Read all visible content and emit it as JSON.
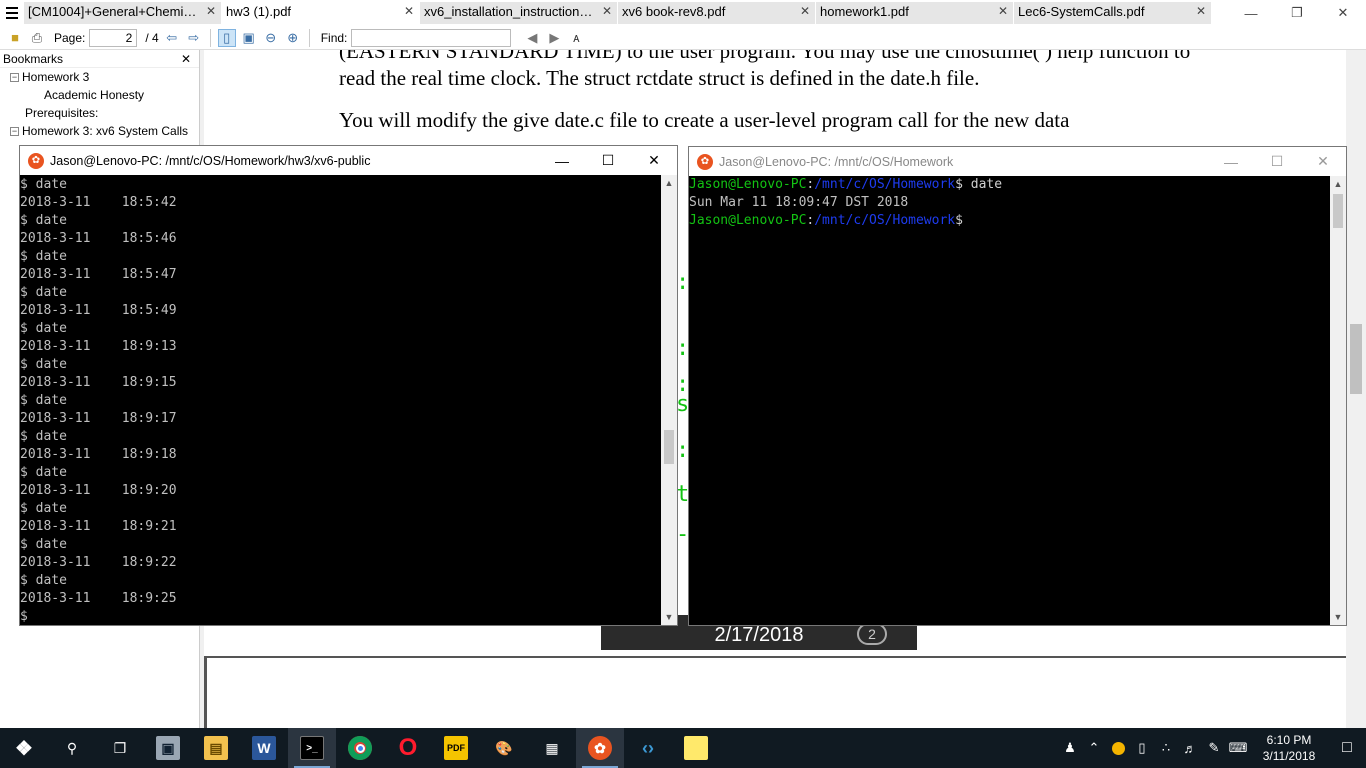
{
  "viewer": {
    "tabs": [
      {
        "label": "[CM1004]+General+Chemistr..."
      },
      {
        "label": "hw3 (1).pdf"
      },
      {
        "label": "xv6_installation_instructions (..."
      },
      {
        "label": "xv6 book-rev8.pdf"
      },
      {
        "label": "homework1.pdf"
      },
      {
        "label": "Lec6-SystemCalls.pdf"
      }
    ],
    "tab_close": "✕",
    "page_label": "Page:",
    "page_value": "2",
    "page_total": "/ 4",
    "find_label": "Find:",
    "bookmarks_title": "Bookmarks",
    "bookmarks_close": "✕",
    "bookmarks": [
      {
        "label": "Homework 3"
      },
      {
        "label": "Academic Honesty"
      },
      {
        "label": "Prerequisites:"
      },
      {
        "label": "Homework 3: xv6 System Calls"
      }
    ],
    "doc_paragraphs": [
      "(EASTERN STANDARD TIME) to the user program. You may use the cmosttime( ) help function to read the real time clock. The struct rctdate struct is defined in the date.h file.",
      "You will modify the give date.c file to create a user-level program call for the new data"
    ],
    "doc_image_text": "2/17/2018",
    "doc_image_badge": "2"
  },
  "term_left": {
    "title": "Jason@Lenovo-PC: /mnt/c/OS/Homework/hw3/xv6-public",
    "lines": [
      "$ date",
      "2018-3-11    18:5:42",
      "$ date",
      "2018-3-11    18:5:46",
      "$ date",
      "2018-3-11    18:5:47",
      "$ date",
      "2018-3-11    18:5:49",
      "$ date",
      "2018-3-11    18:9:13",
      "$ date",
      "2018-3-11    18:9:15",
      "$ date",
      "2018-3-11    18:9:17",
      "$ date",
      "2018-3-11    18:9:18",
      "$ date",
      "2018-3-11    18:9:20",
      "$ date",
      "2018-3-11    18:9:21",
      "$ date",
      "2018-3-11    18:9:22",
      "$ date",
      "2018-3-11    18:9:25",
      "$"
    ]
  },
  "term_right": {
    "title": "Jason@Lenovo-PC: /mnt/c/OS/Homework",
    "user": "Jason@Lenovo-PC",
    "path": "/mnt/c/OS/Homework",
    "cmd": "$ date",
    "output": "Sun Mar 11 18:09:47 DST 2018",
    "prompt_end": "$"
  },
  "bg_leak_chars": [
    ":",
    ":",
    ":",
    "s",
    ":",
    "t",
    "-"
  ],
  "taskbar": {
    "time": "6:10 PM",
    "date": "3/11/2018",
    "apps": [
      "start-button",
      "search-button",
      "task-view-button",
      "app-photos",
      "app-file-explorer",
      "app-word",
      "app-terminal",
      "app-chrome",
      "app-opera",
      "app-pdf-xchange",
      "app-paint",
      "app-calculator",
      "app-ubuntu",
      "app-vscode",
      "app-sticky-notes"
    ]
  },
  "colors": {
    "prompt_green": "#13c313",
    "path_blue": "#1e3cf0",
    "taskbar_bg": "#101a22",
    "ubuntu_orange": "#e95420"
  }
}
